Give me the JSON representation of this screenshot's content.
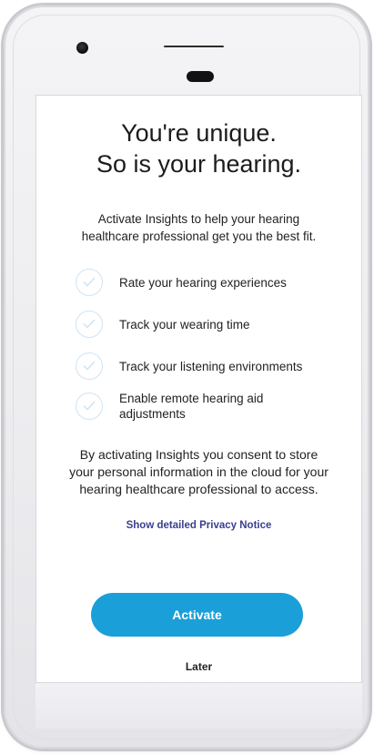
{
  "title": {
    "line1": "You're unique.",
    "line2": "So is your hearing."
  },
  "intro": {
    "line1": "Activate Insights to help your hearing",
    "line2": "healthcare professional get you the best fit."
  },
  "features": [
    {
      "label": "Rate your hearing experiences",
      "icon": "check-circle-icon"
    },
    {
      "label": "Track your wearing time",
      "icon": "check-circle-icon"
    },
    {
      "label": "Track your listening environments",
      "icon": "check-circle-icon"
    },
    {
      "label_line1": "Enable remote hearing aid",
      "label_line2": "adjustments",
      "icon": "check-circle-icon"
    }
  ],
  "consent": {
    "line1": "By activating Insights you consent to store",
    "line2": "your personal information in the cloud for your",
    "line3": "hearing healthcare professional to access."
  },
  "privacy_link": "Show detailed Privacy Notice",
  "buttons": {
    "activate": "Activate",
    "later": "Later"
  },
  "colors": {
    "accent": "#1b9fd8",
    "link": "#3a3f8f",
    "check_circle": "#cfe3f3"
  }
}
